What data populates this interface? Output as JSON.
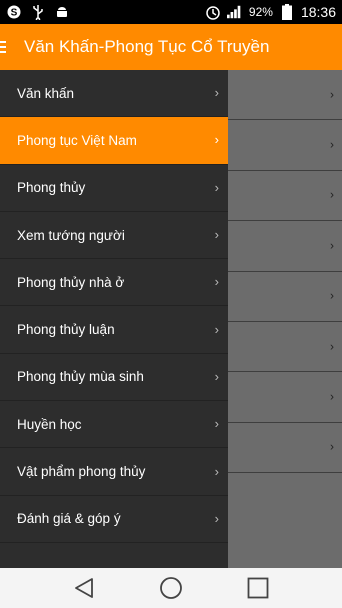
{
  "status_bar": {
    "time": "18:36",
    "battery": "92%",
    "icons": [
      "skype-icon",
      "usb-icon",
      "android-icon",
      "alarm-icon",
      "signal-icon",
      "battery-icon"
    ]
  },
  "app_bar": {
    "title": "Văn Khấn-Phong Tục Cổ Truyền",
    "color": "#ff8a00"
  },
  "drawer": {
    "items": [
      {
        "label": "Văn khấn",
        "active": false
      },
      {
        "label": "Phong tục Việt Nam",
        "active": true
      },
      {
        "label": "Phong thủy",
        "active": false
      },
      {
        "label": "Xem tướng người",
        "active": false
      },
      {
        "label": "Phong thủy nhà ở",
        "active": false
      },
      {
        "label": "Phong thủy luận",
        "active": false
      },
      {
        "label": "Phong thủy mùa sinh",
        "active": false
      },
      {
        "label": "Huyền học",
        "active": false
      },
      {
        "label": "Vật phẩm phong thủy",
        "active": false
      },
      {
        "label": "Đánh giá & góp ý",
        "active": false
      }
    ]
  },
  "content": {
    "row_count": 8
  },
  "nav_bar": {
    "icons": [
      "back-icon",
      "home-icon",
      "recents-icon"
    ]
  }
}
